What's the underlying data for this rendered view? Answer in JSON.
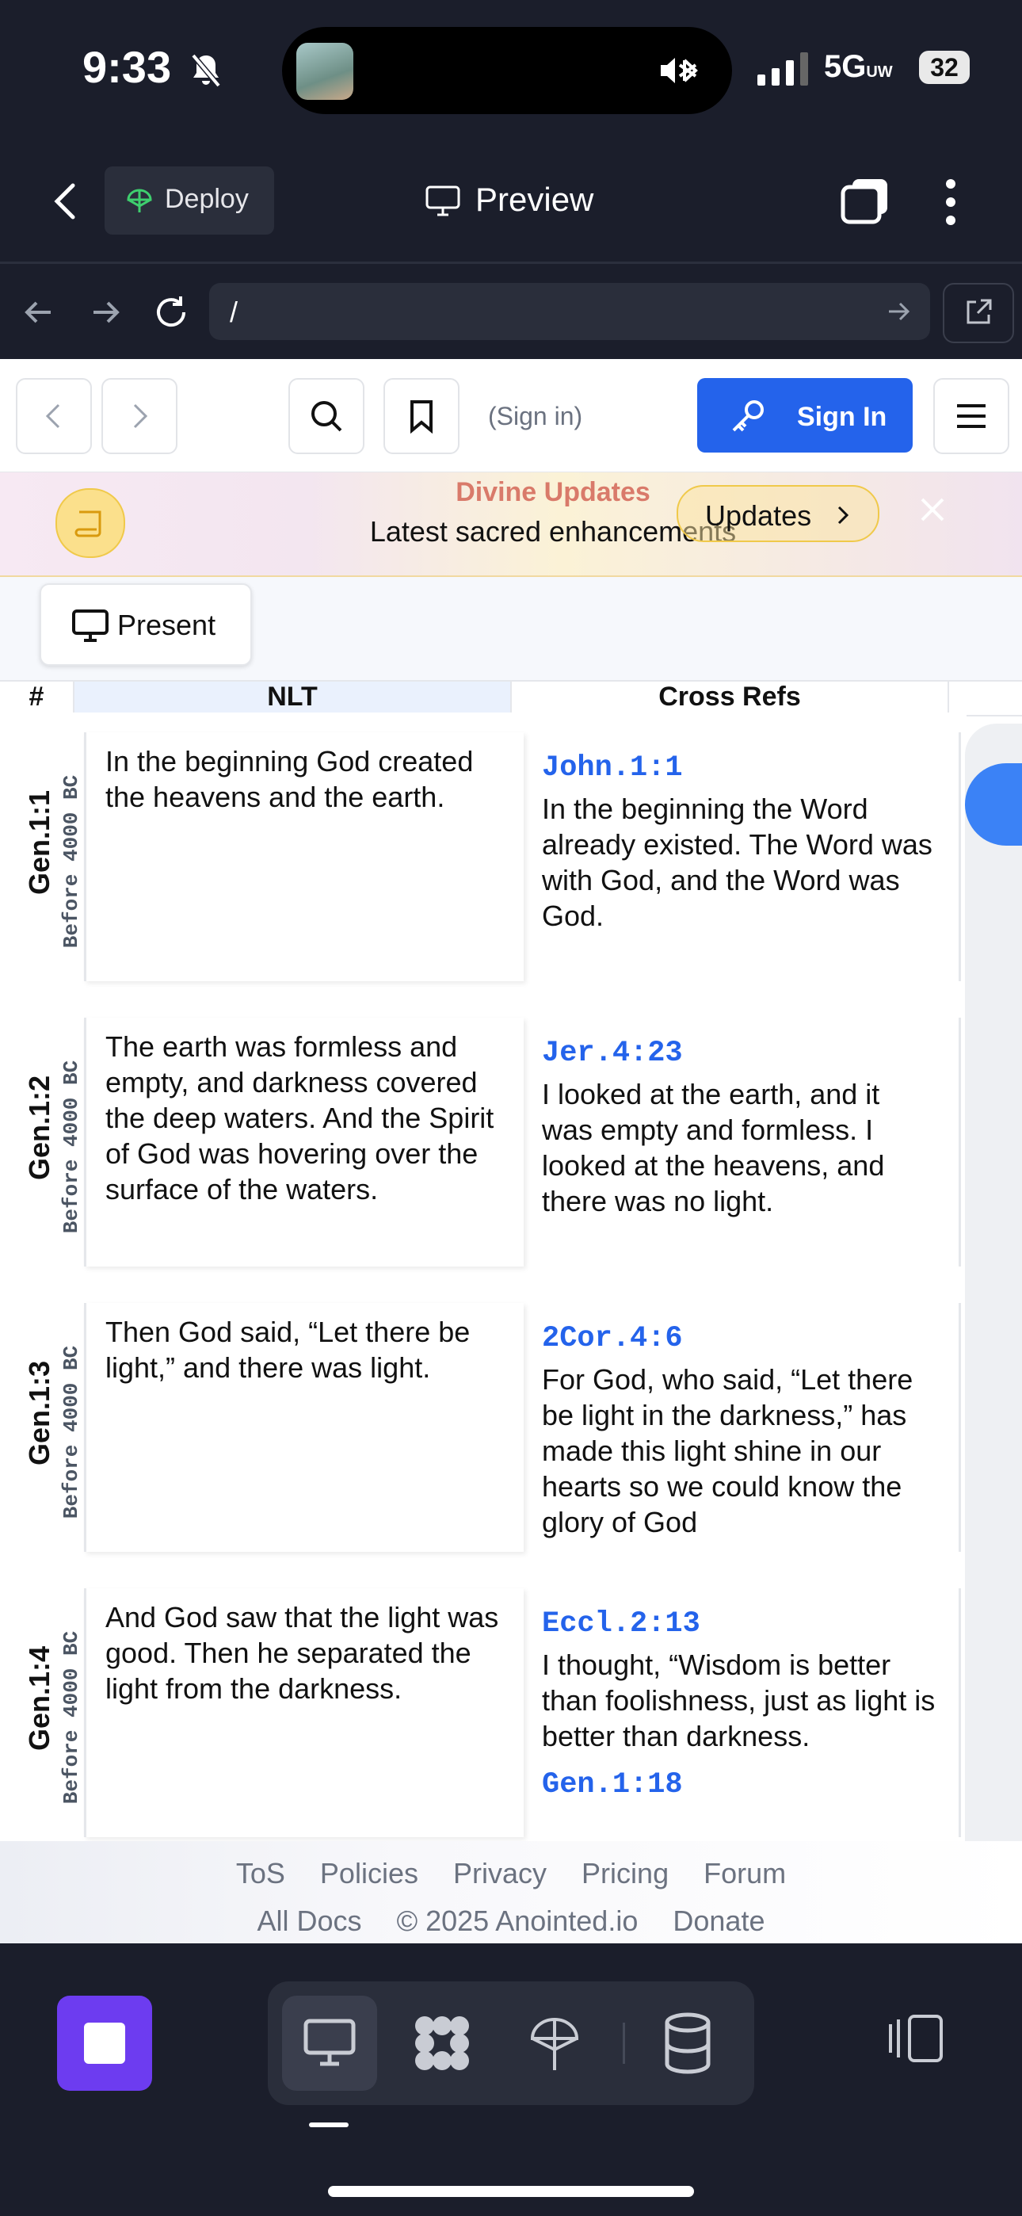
{
  "status_bar": {
    "time": "9:33",
    "network": "5G",
    "network_suffix": "UW",
    "battery": "32"
  },
  "app_header": {
    "deploy_label": "Deploy",
    "preview_label": "Preview"
  },
  "url_bar": {
    "value": "/"
  },
  "nav": {
    "signin_hint": "(Sign in)",
    "signin_button": "Sign In"
  },
  "banner": {
    "title": "Divine Updates",
    "subtitle": "Latest sacred enhancements",
    "button": "Updates"
  },
  "present_button": "Present",
  "table": {
    "headers": [
      "#",
      "NLT",
      "Cross Refs"
    ],
    "rows": [
      {
        "ref": "Gen.1:1",
        "date": "Before 4000 BC",
        "nlt": "In the beginning God created the heavens and the earth.",
        "cross_ref": "John.1:1",
        "cross_text": "In the beginning the Word already existed. The Word was with God, and the Word was God.",
        "cross_ref2": ""
      },
      {
        "ref": "Gen.1:2",
        "date": "Before 4000 BC",
        "nlt": "The earth was formless and empty, and darkness covered the deep waters. And the Spirit of God was hovering over the surface of the waters.",
        "cross_ref": "Jer.4:23",
        "cross_text": "I looked at the earth, and it was empty and formless. I looked at the heavens, and there was no light.",
        "cross_ref2": ""
      },
      {
        "ref": "Gen.1:3",
        "date": "Before 4000 BC",
        "nlt": "Then God said, “Let there be light,” and there was light.",
        "cross_ref": "2Cor.4:6",
        "cross_text": "For God, who said, “Let there be light in the darkness,” has made this light shine in our hearts so we could know the glory of God",
        "cross_ref2": ""
      },
      {
        "ref": "Gen.1:4",
        "date": "Before 4000 BC",
        "nlt": "And God saw that the light was good. Then he separated the light from the darkness.",
        "cross_ref": "Eccl.2:13",
        "cross_text": "I thought, “Wisdom is better than foolishness, just as light is better than darkness.",
        "cross_ref2": "Gen.1:18"
      }
    ]
  },
  "footer": {
    "line1": [
      "ToS",
      "Policies",
      "Privacy",
      "Pricing",
      "Forum"
    ],
    "line2": [
      "All Docs",
      "© 2025 Anointed.io",
      "Donate"
    ]
  },
  "colors": {
    "accent": "#2463eb",
    "toolbar_bg": "#1b1e2b",
    "stop_button": "#6d3cf0",
    "banner_title": "#d97a6a"
  }
}
